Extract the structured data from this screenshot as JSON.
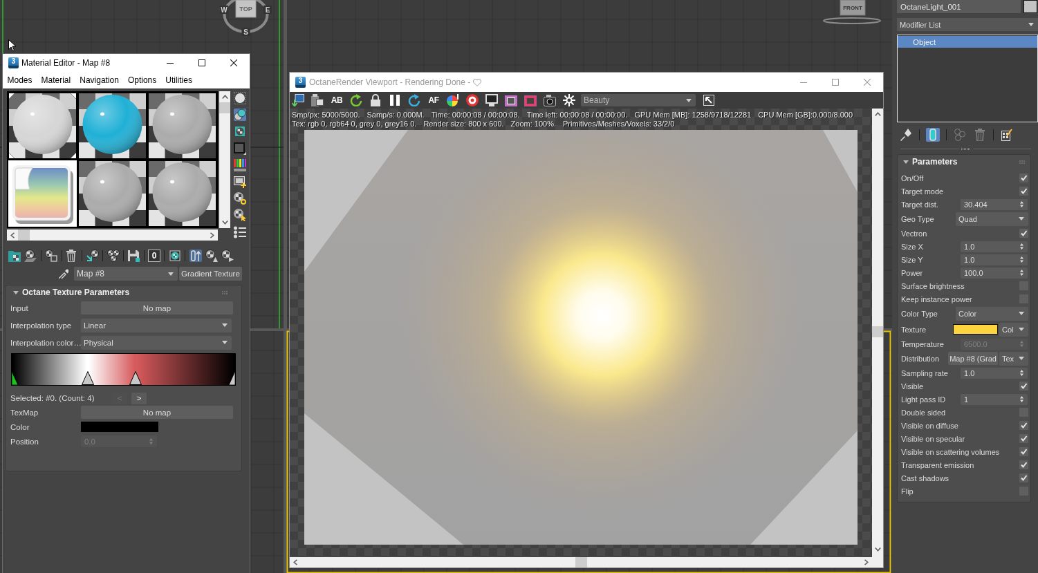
{
  "viewport": {
    "top_cube": {
      "face": "TOP",
      "compass": [
        "W",
        "E",
        "S"
      ]
    },
    "front_cube": {
      "face": "FRONT"
    }
  },
  "material_editor": {
    "icon_label": "3",
    "title": "Material Editor - Map #8",
    "menu": [
      "Modes",
      "Material",
      "Navigation",
      "Options",
      "Utilities"
    ],
    "slots": [
      {
        "kind": "sphere",
        "color": "#d6d6d6",
        "selected": false,
        "hot": true
      },
      {
        "kind": "sphere",
        "color": "#1fb0d6",
        "selected": false,
        "hot": false
      },
      {
        "kind": "sphere",
        "color": "#ababab",
        "selected": false,
        "hot": false
      },
      {
        "kind": "map",
        "selected": true,
        "hot": false
      },
      {
        "kind": "sphere",
        "color": "#ababab",
        "selected": false,
        "hot": false
      },
      {
        "kind": "sphere",
        "color": "#ababab",
        "selected": false,
        "hot": false
      }
    ],
    "side_tools": [
      {
        "on": false
      },
      {
        "on": true
      },
      {
        "on": false
      },
      {
        "on": false
      },
      {
        "on": false
      },
      {
        "on": false
      },
      {
        "on": false
      },
      {
        "on": false
      },
      {
        "on": false
      }
    ],
    "toolbar_groups": [
      [
        {
          "kind": "icon",
          "on": false
        },
        {
          "kind": "icon",
          "on": false
        }
      ],
      [
        {
          "kind": "icon",
          "on": false
        }
      ],
      [
        {
          "kind": "icon",
          "on": false
        }
      ],
      [
        {
          "kind": "icon",
          "on": false
        }
      ],
      [
        {
          "kind": "icon",
          "on": false
        }
      ],
      [
        {
          "kind": "icon",
          "on": false
        }
      ],
      [
        {
          "kind": "text",
          "label": "0",
          "on": false
        }
      ],
      [
        {
          "kind": "icon",
          "on": false
        }
      ],
      [
        {
          "kind": "icon",
          "on": true
        },
        {
          "kind": "icon",
          "on": false
        },
        {
          "kind": "icon",
          "on": false
        }
      ]
    ],
    "map_name": "Map #8",
    "map_type": "Gradient Texture",
    "rollout": {
      "title": "Octane Texture Parameters",
      "expanded": true,
      "rows": [
        {
          "kind": "map",
          "label": "Input",
          "value": "No map"
        },
        {
          "kind": "dropdown",
          "label": "Interpolation type",
          "value": "Linear"
        },
        {
          "kind": "dropdown",
          "label": "Interpolation color…",
          "value": "Physical"
        }
      ],
      "gradient": {
        "stops": [
          {
            "color": "#000000",
            "level": 0,
            "selected": true
          },
          {
            "color": "#ffffff",
            "level": 0.34,
            "selected": false
          },
          {
            "color": "#d65a5c",
            "level": 0.555,
            "selected": false
          },
          {
            "color": "#000000",
            "level": 1,
            "selected": false
          }
        ]
      },
      "selection": {
        "text": "Selected: #0. (Count: 4)",
        "buttons": [
          {
            "label": "<",
            "disabled": true
          },
          {
            "label": ">",
            "disabled": false
          }
        ]
      },
      "stop_rows": [
        {
          "kind": "map",
          "label": "TexMap",
          "value": "No map"
        },
        {
          "kind": "color",
          "label": "Color",
          "color": "#000000"
        },
        {
          "kind": "spinner",
          "label": "Position",
          "value": "0.0",
          "disabled": true
        }
      ]
    }
  },
  "octane": {
    "icon_label": "3",
    "title": "OctaneRender Viewport - Rendering Done -",
    "toolbar": [
      {
        "kind": "icon"
      },
      {
        "kind": "icon"
      },
      {
        "kind": "text",
        "label": "AB"
      },
      {
        "kind": "icon"
      },
      {
        "kind": "icon"
      },
      {
        "kind": "icon"
      },
      {
        "kind": "icon"
      },
      {
        "kind": "text",
        "label": "AF"
      },
      {
        "kind": "icon"
      },
      {
        "kind": "icon"
      },
      {
        "kind": "icon"
      },
      {
        "kind": "icon"
      },
      {
        "kind": "icon"
      },
      {
        "kind": "icon"
      },
      {
        "kind": "icon"
      }
    ],
    "pass": "Beauty",
    "info": [
      [
        "Smp/px: 5000/5000.",
        "Samp/s: 0.000M.",
        "Time: 00:00:08 / 00:00:08.",
        "Time left: 00:00:08 / 00:00:00.",
        "GPU Mem [MB]: 1258/9718/12281",
        "CPU Mem [GB]:0.000/8.000"
      ],
      [
        "Tex: rgb 0, rgb64 0, grey 0, grey16 0.",
        "Render size: 800 x 600.",
        "Zoom: 100%.",
        "Primitives/Meshes/Voxels: 33/2/0"
      ]
    ]
  },
  "command_panel": {
    "object_name": "OctaneLight_001",
    "modifier_list": "Modifier List",
    "stack": [
      {
        "label": "Object",
        "selected": true
      }
    ],
    "stack_tools": [
      {
        "on": false,
        "disabled": false
      },
      {
        "on": true,
        "disabled": false
      },
      {
        "on": false,
        "disabled": true
      },
      {
        "on": false,
        "disabled": true
      },
      {
        "on": false,
        "disabled": false
      }
    ],
    "rollout": {
      "title": "Parameters",
      "expanded": true,
      "rows": [
        {
          "kind": "checkbox",
          "label": "On/Off",
          "checked": true
        },
        {
          "kind": "checkbox",
          "label": "Target mode",
          "checked": true
        },
        {
          "kind": "spinner",
          "label": "Target dist.",
          "value": "30.404",
          "disabled": false
        },
        {
          "kind": "dropdown",
          "label": "Geo Type",
          "value": "Quad"
        },
        {
          "kind": "checkbox",
          "label": "Vectron",
          "checked": true
        },
        {
          "kind": "spinner",
          "label": "Size X",
          "value": "1.0",
          "disabled": false
        },
        {
          "kind": "spinner",
          "label": "Size Y",
          "value": "1.0",
          "disabled": false
        },
        {
          "kind": "spinner",
          "label": "Power",
          "value": "100.0",
          "disabled": false
        },
        {
          "kind": "checkbox",
          "label": "Surface brightness",
          "checked": false
        },
        {
          "kind": "checkbox",
          "label": "Keep instance power",
          "checked": false
        },
        {
          "kind": "dropdown",
          "label": "Color Type",
          "value": "Color"
        },
        {
          "kind": "color",
          "label": "Texture",
          "color": "#fcd43e",
          "mode": "Col"
        },
        {
          "kind": "spinner",
          "label": "Temperature",
          "value": "6500.0",
          "disabled": true
        },
        {
          "kind": "map",
          "label": "Distribution",
          "value": "Map #8 (Grad",
          "mode": "Tex"
        },
        {
          "kind": "spinner",
          "label": "Sampling rate",
          "value": "1.0",
          "disabled": false
        },
        {
          "kind": "checkbox",
          "label": "Visible",
          "checked": true
        },
        {
          "kind": "spinner",
          "label": "Light pass ID",
          "value": "1",
          "disabled": false
        },
        {
          "kind": "checkbox",
          "label": "Double sided",
          "checked": false
        },
        {
          "kind": "checkbox",
          "label": "Visible on diffuse",
          "checked": true
        },
        {
          "kind": "checkbox",
          "label": "Visible on specular",
          "checked": true
        },
        {
          "kind": "checkbox",
          "label": "Visible on scattering volumes",
          "checked": true
        },
        {
          "kind": "checkbox",
          "label": "Transparent emission",
          "checked": true
        },
        {
          "kind": "checkbox",
          "label": "Cast shadows",
          "checked": true
        },
        {
          "kind": "checkbox",
          "label": "Flip",
          "checked": false
        }
      ]
    }
  }
}
